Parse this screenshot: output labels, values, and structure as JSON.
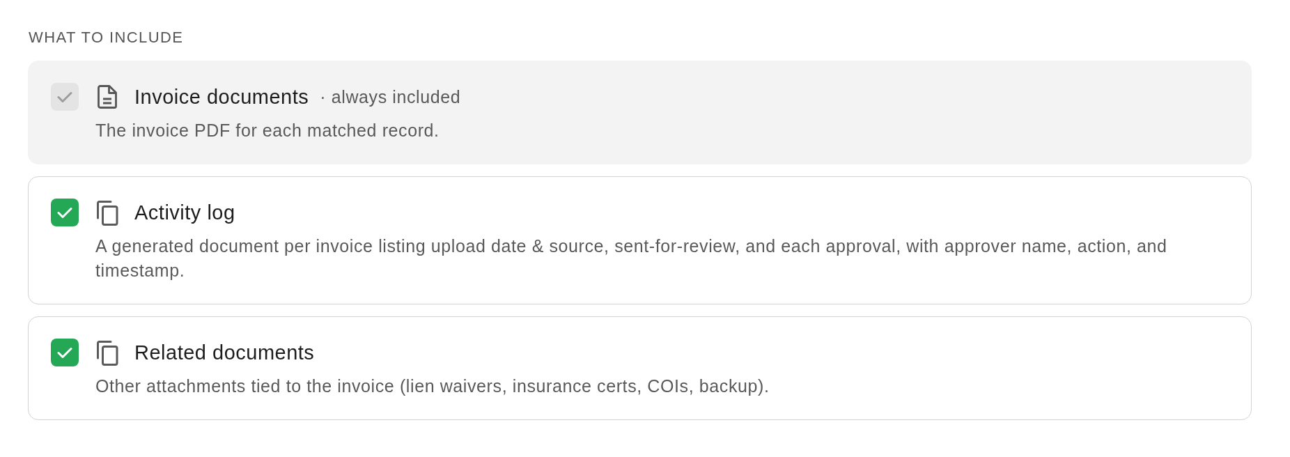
{
  "section": {
    "heading": "WHAT TO INCLUDE"
  },
  "options": [
    {
      "kind": "document",
      "title": "Invoice documents",
      "note": "· always included",
      "description": "The invoice PDF for each matched record.",
      "checked": true,
      "disabled": true
    },
    {
      "kind": "copies",
      "title": "Activity log",
      "description": "A generated document per invoice listing upload date & source, sent-for-review, and each approval, with approver name, action, and timestamp.",
      "checked": true,
      "disabled": false
    },
    {
      "kind": "copies",
      "title": "Related documents",
      "description": "Other attachments tied to the invoice (lien waivers, insurance certs, COIs, backup).",
      "checked": true,
      "disabled": false
    }
  ]
}
